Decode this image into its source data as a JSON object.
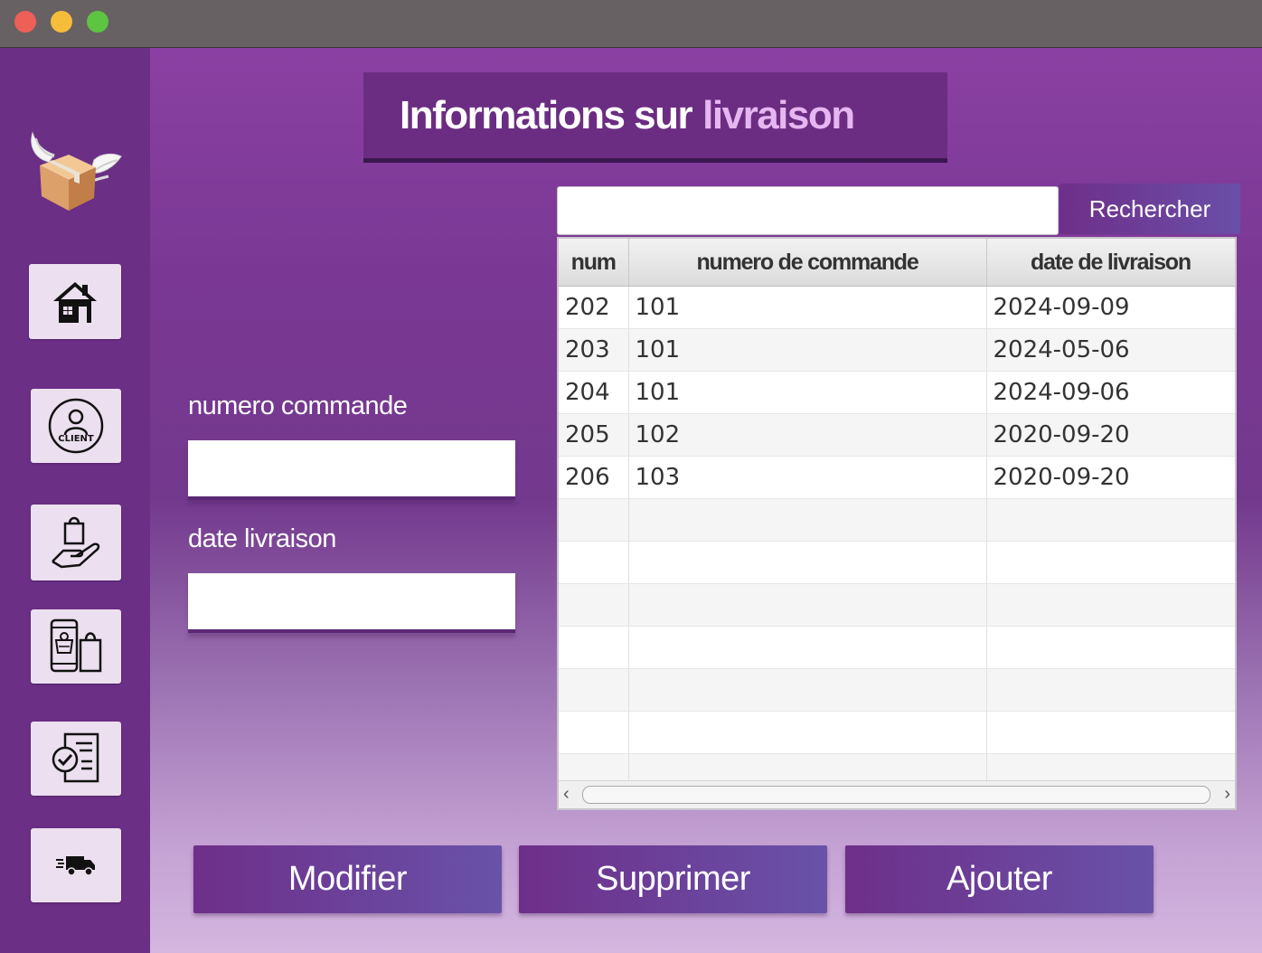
{
  "window": {
    "controls": [
      "close",
      "minimize",
      "maximize"
    ]
  },
  "sidebar": {
    "logo": "winged-package-icon",
    "items": [
      {
        "icon": "home-icon"
      },
      {
        "icon": "client-icon",
        "label": "CLIENT"
      },
      {
        "icon": "hand-shopping-bag-icon"
      },
      {
        "icon": "mobile-shopping-icon"
      },
      {
        "icon": "checklist-icon"
      },
      {
        "icon": "delivery-truck-icon"
      }
    ]
  },
  "header": {
    "title_part1": "Informations sur",
    "title_part2": "livraison"
  },
  "form": {
    "numero_label": "numero commande",
    "numero_value": "",
    "date_label": "date livraison",
    "date_value": ""
  },
  "search": {
    "value": "",
    "button_label": "Rechercher"
  },
  "table": {
    "columns": [
      "num",
      "numero de commande",
      "date de livraison"
    ],
    "rows": [
      [
        "202",
        "101",
        "2024-09-09"
      ],
      [
        "203",
        "101",
        "2024-05-06"
      ],
      [
        "204",
        "101",
        "2024-09-06"
      ],
      [
        "205",
        "102",
        "2020-09-20"
      ],
      [
        "206",
        "103",
        "2020-09-20"
      ]
    ]
  },
  "actions": {
    "modifier": "Modifier",
    "supprimer": "Supprimer",
    "ajouter": "Ajouter"
  },
  "colors": {
    "sidebar": "#6b2f86",
    "accent": "#6e2f89",
    "title_highlight": "#e6b6f1",
    "button_gradient_end": "#6952a9"
  }
}
